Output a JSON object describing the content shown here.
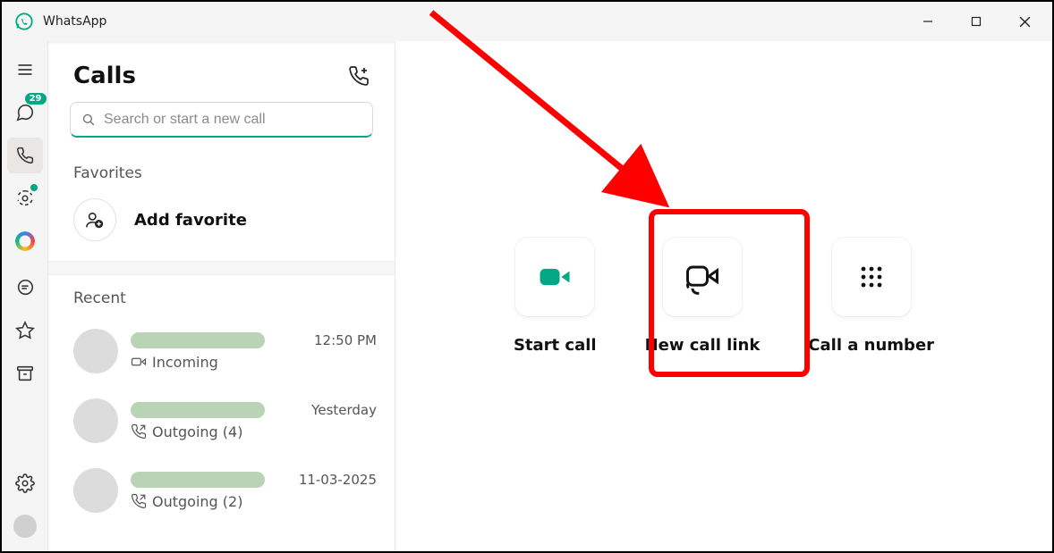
{
  "app": {
    "title": "WhatsApp"
  },
  "rail": {
    "chat_badge": "29"
  },
  "sidebar": {
    "title": "Calls",
    "search_placeholder": "Search or start a new call",
    "favorites_label": "Favorites",
    "add_favorite_label": "Add favorite",
    "recent_label": "Recent",
    "calls": [
      {
        "direction": "Incoming",
        "time": "12:50 PM",
        "icon": "video-incoming"
      },
      {
        "direction": "Outgoing (4)",
        "time": "Yesterday",
        "icon": "call-outgoing"
      },
      {
        "direction": "Outgoing (2)",
        "time": "11-03-2025",
        "icon": "call-outgoing"
      }
    ]
  },
  "main": {
    "actions": {
      "start_call": "Start call",
      "new_call_link": "New call link",
      "call_a_number": "Call a number"
    }
  }
}
